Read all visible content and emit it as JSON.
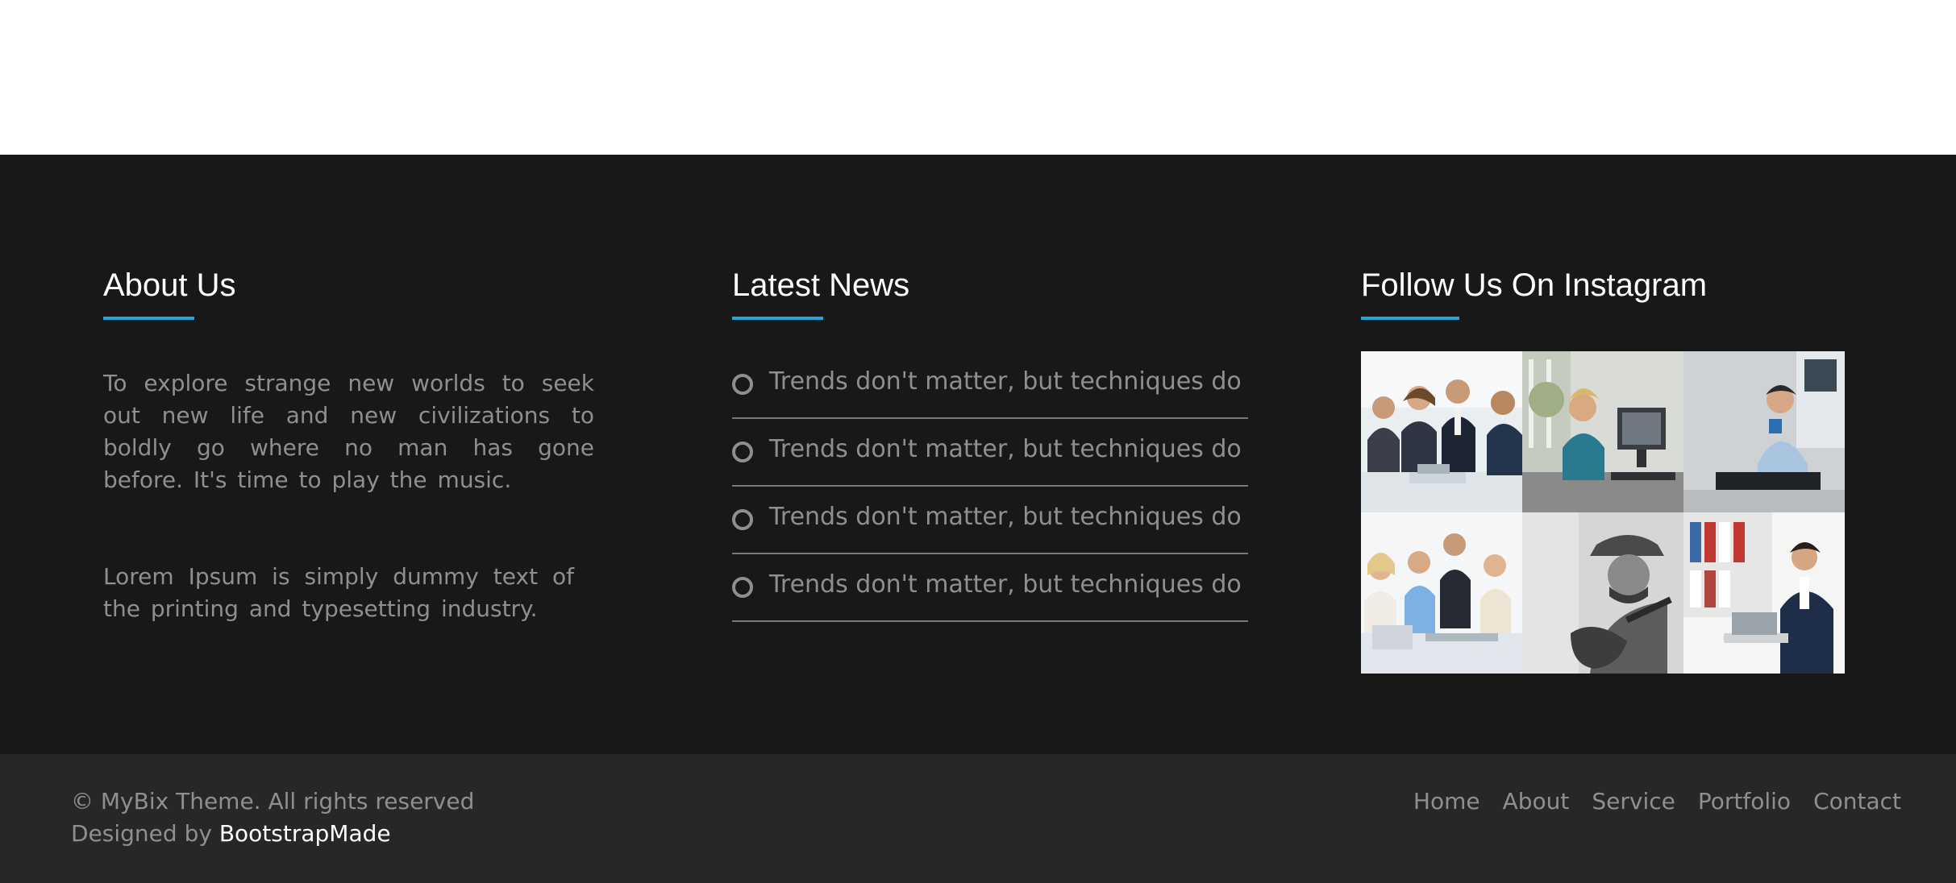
{
  "about": {
    "title": "About Us",
    "paragraph_1": "To explore strange new worlds to seek out new life and new civilizations to boldly go where no man has gone before. It's time to play the music.",
    "paragraph_2": "Lorem Ipsum is simply dummy text of the printing and typesetting industry."
  },
  "news": {
    "title": "Latest News",
    "items": [
      {
        "icon": "circle-icon",
        "text": "Trends don't matter, but techniques do"
      },
      {
        "icon": "circle-icon",
        "text": "Trends don't matter, but techniques do"
      },
      {
        "icon": "circle-icon",
        "text": "Trends don't matter, but techniques do"
      },
      {
        "icon": "circle-icon",
        "text": "Trends don't matter, but techniques do"
      }
    ]
  },
  "instagram": {
    "title": "Follow Us On Instagram",
    "photos": [
      "team-meeting-photo",
      "woman-at-computer-photo",
      "man-with-coffee-photo",
      "office-team-photo",
      "guitarist-photo",
      "man-at-laptop-photo"
    ]
  },
  "footer": {
    "copyright": "© MyBix Theme. All rights reserved",
    "designed_by_prefix": "Designed by ",
    "designer": "BootstrapMade",
    "nav": [
      "Home",
      "About",
      "Service",
      "Portfolio",
      "Contact"
    ]
  },
  "colors": {
    "accent": "#1fa8d8",
    "footer_bg": "#181818",
    "bottom_bar_bg": "#272727",
    "muted_text": "#8f8f8f",
    "heading_text": "#ffffff"
  }
}
